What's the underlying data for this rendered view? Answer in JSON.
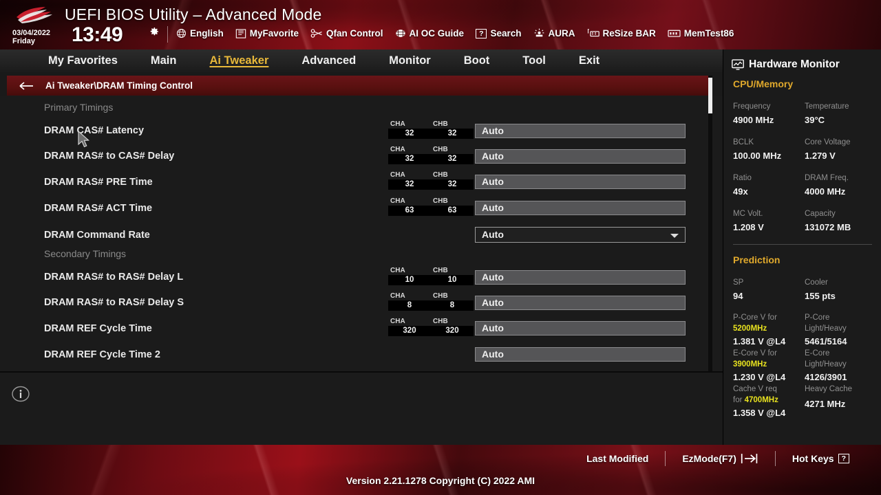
{
  "header": {
    "title": "UEFI BIOS Utility – Advanced Mode",
    "date": "03/04/2022",
    "weekday": "Friday",
    "time": "13:49",
    "gear_icon": "gear-icon",
    "items": [
      {
        "label": "English",
        "icon": "globe-icon"
      },
      {
        "label": "MyFavorite",
        "icon": "star-list-icon"
      },
      {
        "label": "Qfan Control",
        "icon": "fan-icon"
      },
      {
        "label": "AI OC Guide",
        "icon": "brain-icon"
      },
      {
        "label": "Search",
        "icon": "question-box-icon"
      },
      {
        "label": "AURA",
        "icon": "lighting-icon"
      },
      {
        "label": "ReSize BAR",
        "icon": "resize-bar-icon"
      },
      {
        "label": "MemTest86",
        "icon": "memory-icon"
      }
    ]
  },
  "nav": {
    "tabs": [
      {
        "label": "My Favorites",
        "active": false
      },
      {
        "label": "Main",
        "active": false
      },
      {
        "label": "Ai Tweaker",
        "active": true
      },
      {
        "label": "Advanced",
        "active": false
      },
      {
        "label": "Monitor",
        "active": false
      },
      {
        "label": "Boot",
        "active": false
      },
      {
        "label": "Tool",
        "active": false
      },
      {
        "label": "Exit",
        "active": false
      }
    ],
    "active_color": "#e8b83a"
  },
  "breadcrumb": {
    "back_icon": "arrow-left-icon",
    "path": "Ai Tweaker\\DRAM Timing Control"
  },
  "main": {
    "sections": [
      {
        "heading": "Primary Timings",
        "rows": [
          {
            "label": "DRAM CAS# Latency",
            "cha_label": "CHA",
            "cha": "32",
            "chb_label": "CHB",
            "chb": "32",
            "value": "Auto",
            "control": "input"
          },
          {
            "label": "DRAM RAS# to CAS# Delay",
            "cha_label": "CHA",
            "cha": "32",
            "chb_label": "CHB",
            "chb": "32",
            "value": "Auto",
            "control": "input"
          },
          {
            "label": "DRAM RAS# PRE Time",
            "cha_label": "CHA",
            "cha": "32",
            "chb_label": "CHB",
            "chb": "32",
            "value": "Auto",
            "control": "input"
          },
          {
            "label": "DRAM RAS# ACT Time",
            "cha_label": "CHA",
            "cha": "63",
            "chb_label": "CHB",
            "chb": "63",
            "value": "Auto",
            "control": "input"
          },
          {
            "label": "DRAM Command Rate",
            "cha_label": "",
            "cha": "",
            "chb_label": "",
            "chb": "",
            "value": "Auto",
            "control": "select"
          }
        ]
      },
      {
        "heading": "Secondary Timings",
        "rows": [
          {
            "label": "DRAM RAS# to RAS# Delay L",
            "cha_label": "CHA",
            "cha": "10",
            "chb_label": "CHB",
            "chb": "10",
            "value": "Auto",
            "control": "input"
          },
          {
            "label": "DRAM RAS# to RAS# Delay S",
            "cha_label": "CHA",
            "cha": "8",
            "chb_label": "CHB",
            "chb": "8",
            "value": "Auto",
            "control": "input"
          },
          {
            "label": "DRAM REF Cycle Time",
            "cha_label": "CHA",
            "cha": "320",
            "chb_label": "CHB",
            "chb": "320",
            "value": "Auto",
            "control": "input"
          },
          {
            "label": "DRAM REF Cycle Time 2",
            "cha_label": "",
            "cha": "",
            "chb_label": "",
            "chb": "",
            "value": "Auto",
            "control": "input"
          }
        ]
      }
    ],
    "info_icon": "info-circle-icon"
  },
  "sidebar": {
    "title": "Hardware Monitor",
    "title_icon": "monitor-icon",
    "groups": [
      {
        "name": "CPU/Memory",
        "pairs": [
          {
            "k1": "Frequency",
            "v1": "4900 MHz",
            "k2": "Temperature",
            "v2": "39°C"
          },
          {
            "k1": "BCLK",
            "v1": "100.00 MHz",
            "k2": "Core Voltage",
            "v2": "1.279 V"
          },
          {
            "k1": "Ratio",
            "v1": "49x",
            "k2": "DRAM Freq.",
            "v2": "4000 MHz"
          },
          {
            "k1": "MC Volt.",
            "v1": "1.208 V",
            "k2": "Capacity",
            "v2": "131072 MB"
          }
        ]
      }
    ],
    "prediction": {
      "name": "Prediction",
      "sp_label": "SP",
      "sp_value": "94",
      "cooler_label": "Cooler",
      "cooler_value": "155 pts",
      "pcore_v_label_1": "P-Core V for",
      "pcore_v_freq": "5200MHz",
      "pcore_v_value": "1.381 V @L4",
      "pcore_lh_label_1": "P-Core",
      "pcore_lh_label_2": "Light/Heavy",
      "pcore_lh_value": "5461/5164",
      "ecore_v_label_1": "E-Core V for",
      "ecore_v_freq": "3900MHz",
      "ecore_v_value": "1.230 V @L4",
      "ecore_lh_label_1": "E-Core",
      "ecore_lh_label_2": "Light/Heavy",
      "ecore_lh_value": "4126/3901",
      "cache_label_1": "Cache V req",
      "cache_label_2": "for",
      "cache_freq": "4700MHz",
      "cache_value": "1.358 V @L4",
      "heavy_cache_label": "Heavy Cache",
      "heavy_cache_value": "4271 MHz"
    },
    "highlight_color": "#e8e21f",
    "group_color": "#e0a92c"
  },
  "footer": {
    "last_modified": "Last Modified",
    "ezmode": "EzMode(F7)",
    "ezmode_icon": "exit-arrow-icon",
    "hotkeys": "Hot Keys",
    "hotkeys_icon": "question-box-icon",
    "version": "Version 2.21.1278 Copyright (C) 2022 AMI"
  }
}
